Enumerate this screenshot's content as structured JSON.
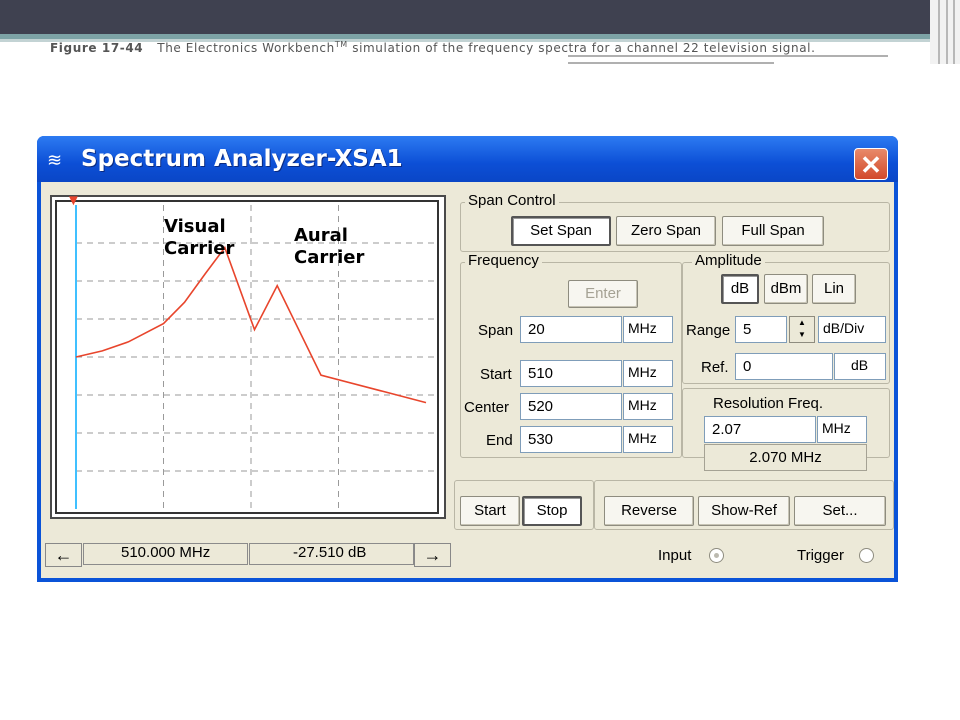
{
  "slide": {
    "figure_number": "Figure 17-44",
    "caption_start": "The Electronics Workbench",
    "caption_tm": "TM",
    "caption_end": " simulation of the frequency spectra for a channel 22 television signal."
  },
  "window": {
    "title": "Spectrum Analyzer-XSA1",
    "close_label": "✕"
  },
  "graph": {
    "visual_label_line1": "Visual",
    "visual_label_line2": "Carrier",
    "aural_label_line1": "Aural",
    "aural_label_line2": "Carrier",
    "marker": "▼",
    "trace_color": "#e8452c",
    "cursor_color": "#40c0ff"
  },
  "chart_data": {
    "type": "line",
    "x": [
      510,
      511.5,
      513,
      515,
      516.2,
      517.4,
      518.5,
      520.2,
      521.5,
      524,
      530
    ],
    "y": [
      -100,
      -96,
      -90,
      -78,
      -64,
      -45,
      -28,
      -82,
      -53,
      -112,
      -130
    ],
    "title": "",
    "xlabel": "",
    "ylabel": "",
    "xlim": [
      510,
      530
    ],
    "grid": true,
    "annotations": [
      "Visual Carrier",
      "Aural Carrier"
    ]
  },
  "readout": {
    "left_arrow": "←",
    "frequency": "510.000 MHz",
    "amplitude": "-27.510  dB",
    "right_arrow": "→"
  },
  "span_control": {
    "label": "Span Control",
    "set_span": "Set Span",
    "zero_span": "Zero Span",
    "full_span": "Full Span"
  },
  "frequency": {
    "label": "Frequency",
    "enter": "Enter",
    "span_label": "Span",
    "span_value": "20",
    "span_unit": "MHz",
    "start_label": "Start",
    "start_value": "510",
    "start_unit": "MHz",
    "center_label": "Center",
    "center_value": "520",
    "center_unit": "MHz",
    "end_label": "End",
    "end_value": "530",
    "end_unit": "MHz"
  },
  "amplitude": {
    "label": "Amplitude",
    "db": "dB",
    "dbm": "dBm",
    "lin": "Lin",
    "range_label": "Range",
    "range_value": "5",
    "range_unit": "dB/Div",
    "ref_label": "Ref.",
    "ref_value": "0",
    "ref_unit": "dB"
  },
  "resolution": {
    "label": "Resolution  Freq.",
    "value": "2.07",
    "unit": "MHz",
    "display": "2.070 MHz"
  },
  "bottom": {
    "start": "Start",
    "stop": "Stop",
    "reverse": "Reverse",
    "show_ref": "Show-Ref",
    "set": "Set...",
    "input_label": "Input",
    "trigger_label": "Trigger"
  }
}
